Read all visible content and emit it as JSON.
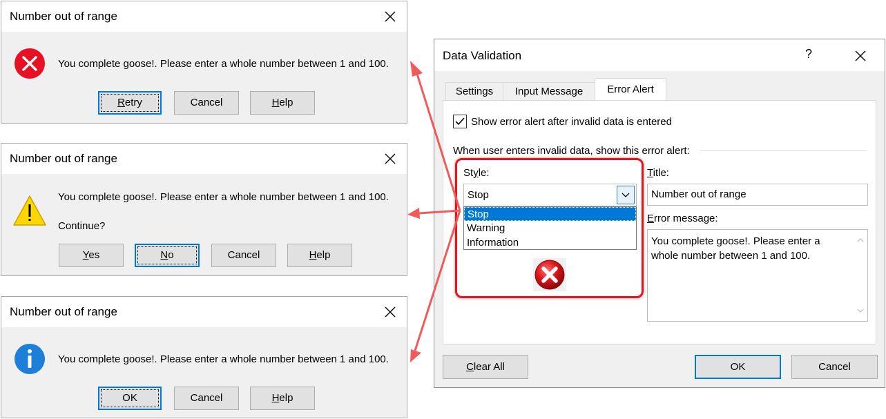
{
  "stop_box": {
    "title": "Number out of range",
    "message": "You complete goose!. Please enter a whole number between 1 and 100.",
    "buttons": [
      "Retry",
      "Cancel",
      "Help"
    ]
  },
  "warning_box": {
    "title": "Number out of range",
    "message": "You complete goose!. Please enter a whole number between 1 and 100.",
    "prompt": "Continue?",
    "buttons": [
      "Yes",
      "No",
      "Cancel",
      "Help"
    ]
  },
  "info_box": {
    "title": "Number out of range",
    "message": "You complete goose!. Please enter a whole number between 1 and 100.",
    "buttons": [
      "OK",
      "Cancel",
      "Help"
    ]
  },
  "data_validation": {
    "title": "Data Validation",
    "help_glyph": "?",
    "tabs": [
      "Settings",
      "Input Message",
      "Error Alert"
    ],
    "active_tab": "Error Alert",
    "show_alert_label": "Show error alert after invalid data is entered",
    "show_alert_checked": true,
    "group_label": "When user enters invalid data, show this error alert:",
    "style_label": "Style:",
    "style_value": "Stop",
    "style_options": [
      "Stop",
      "Warning",
      "Information"
    ],
    "title_label": "Title:",
    "title_value": "Number out of range",
    "error_message_label": "Error message:",
    "error_message_value": "You complete goose!. Please enter a whole number between 1 and 100.",
    "clear_all_label": "Clear All",
    "ok_label": "OK",
    "cancel_label": "Cancel"
  },
  "colors": {
    "highlight": "#ff0000",
    "arrow": "#f05a5a",
    "selection": "#0078d7",
    "stop_red": "#e81123",
    "warning_yellow": "#ffd700",
    "info_blue": "#1e7fd8"
  }
}
